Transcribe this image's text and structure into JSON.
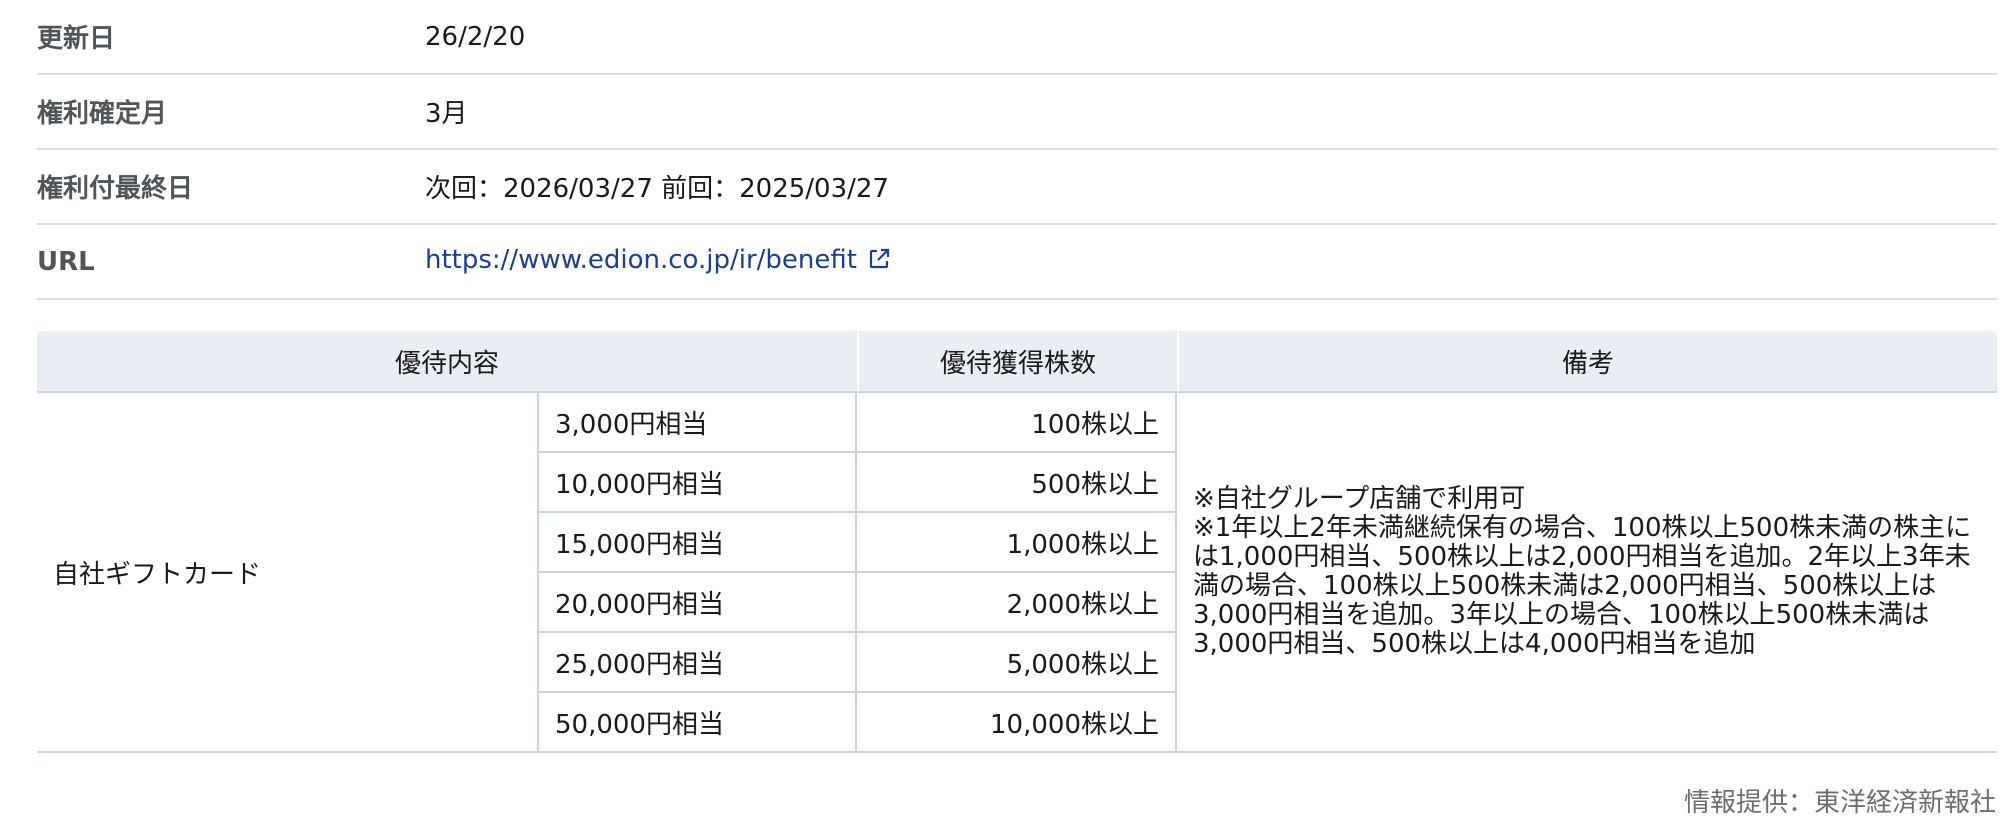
{
  "info": {
    "update": {
      "label": "更新日",
      "value": "26/2/20"
    },
    "record_month": {
      "label": "権利確定月",
      "value": "3月"
    },
    "last_date": {
      "label": "権利付最終日",
      "value": "次回：2026/03/27 前回：2025/03/27"
    },
    "url": {
      "label": "URL",
      "value": "https://www.edion.co.jp/ir/benefit",
      "icon": "external-link-icon"
    }
  },
  "table": {
    "headers": {
      "content": "優待内容",
      "shares": "優待獲得株数",
      "notes": "備考"
    },
    "item": "自社ギフトカード",
    "rows": [
      {
        "amount": "3,000円相当",
        "shares": "100株以上"
      },
      {
        "amount": "10,000円相当",
        "shares": "500株以上"
      },
      {
        "amount": "15,000円相当",
        "shares": "1,000株以上"
      },
      {
        "amount": "20,000円相当",
        "shares": "2,000株以上"
      },
      {
        "amount": "25,000円相当",
        "shares": "5,000株以上"
      },
      {
        "amount": "50,000円相当",
        "shares": "10,000株以上"
      }
    ],
    "note_line1": "※自社グループ店舗で利用可",
    "note_line2": "※1年以上2年未満継続保有の場合、100株以上500株未満の株主には1,000円相当、500株以上は2,000円相当を追加。2年以上3年未満の場合、100株以上500株未満は2,000円相当、500株以上は3,000円相当を追加。3年以上の場合、100株以上500株未満は3,000円相当、500株以上は4,000円相当を追加"
  },
  "footer": "情報提供：東洋経済新報社",
  "colors": {
    "link": "#1a3f8e",
    "header_bg": "#e9eef5",
    "border": "#c9d3de"
  }
}
